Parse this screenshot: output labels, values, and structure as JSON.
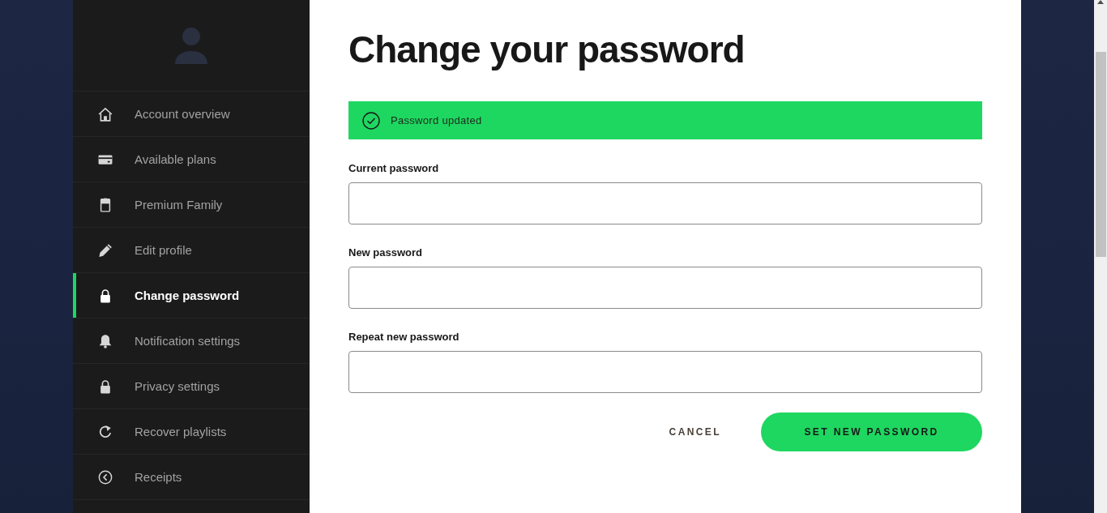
{
  "sidebar": {
    "items": [
      {
        "label": "Account overview",
        "selected": false
      },
      {
        "label": "Available plans",
        "selected": false
      },
      {
        "label": "Premium Family",
        "selected": false
      },
      {
        "label": "Edit profile",
        "selected": false
      },
      {
        "label": "Change password",
        "selected": true
      },
      {
        "label": "Notification settings",
        "selected": false
      },
      {
        "label": "Privacy settings",
        "selected": false
      },
      {
        "label": "Recover playlists",
        "selected": false
      },
      {
        "label": "Receipts",
        "selected": false
      }
    ]
  },
  "main": {
    "title": "Change your password",
    "alert": {
      "message": "Password updated"
    },
    "fields": [
      {
        "label": "Current password"
      },
      {
        "label": "New password"
      },
      {
        "label": "Repeat new password"
      }
    ],
    "buttons": [
      {
        "label": "CANCEL",
        "kind": "text"
      },
      {
        "label": "SET NEW PASSWORD",
        "kind": "primary"
      }
    ]
  }
}
